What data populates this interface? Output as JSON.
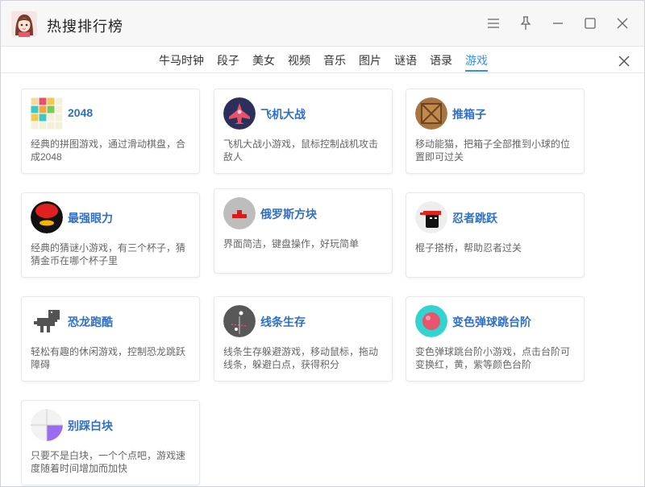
{
  "app": {
    "title": "热搜排行榜"
  },
  "tabs": [
    {
      "label": "牛马时钟"
    },
    {
      "label": "段子"
    },
    {
      "label": "美女"
    },
    {
      "label": "视频"
    },
    {
      "label": "音乐"
    },
    {
      "label": "图片"
    },
    {
      "label": "谜语"
    },
    {
      "label": "语录"
    },
    {
      "label": "游戏",
      "active": true
    }
  ],
  "games": [
    {
      "name": "2048",
      "desc": "经典的拼图游戏，通过滑动棋盘，合成2048",
      "icon": "grid-tiles-icon"
    },
    {
      "name": "飞机大战",
      "desc": "飞机大战小游戏，鼠标控制战机攻击敌人",
      "icon": "fighter-plane-icon"
    },
    {
      "name": "推箱子",
      "desc": "移动能猫，把箱子全部推到小球的位置即可过关",
      "icon": "wooden-crate-icon"
    },
    {
      "name": "最强眼力",
      "desc": "经典的猜谜小游戏，有三个杯子，猜猜金币在哪个杯子里",
      "icon": "cup-coin-icon"
    },
    {
      "name": "俄罗斯方块",
      "desc": "界面简洁，键盘操作，好玩简单",
      "icon": "tetromino-icon"
    },
    {
      "name": "忍者跳跃",
      "desc": "棍子搭桥，帮助忍者过关",
      "icon": "ninja-icon"
    },
    {
      "name": "恐龙跑酷",
      "desc": "轻松有趣的休闲游戏，控制恐龙跳跃障碍",
      "icon": "pixel-dinosaur-icon"
    },
    {
      "name": "线条生存",
      "desc": "线条生存躲避游戏，移动鼠标，拖动线条，躲避白点，获得积分",
      "icon": "dots-line-icon"
    },
    {
      "name": "变色弹球跳台阶",
      "desc": "变色弹球跳台阶小游戏，点击台阶可变换红，黄，紫等颜色台阶",
      "icon": "bouncing-ball-icon"
    },
    {
      "name": "别踩白块",
      "desc": "只要不是白块，一个个点吧，游戏速度随着时间增加而加快",
      "icon": "piano-tiles-icon"
    }
  ],
  "colors": {
    "accent": "#3a8ee6",
    "title_link": "#2f6fc8"
  }
}
